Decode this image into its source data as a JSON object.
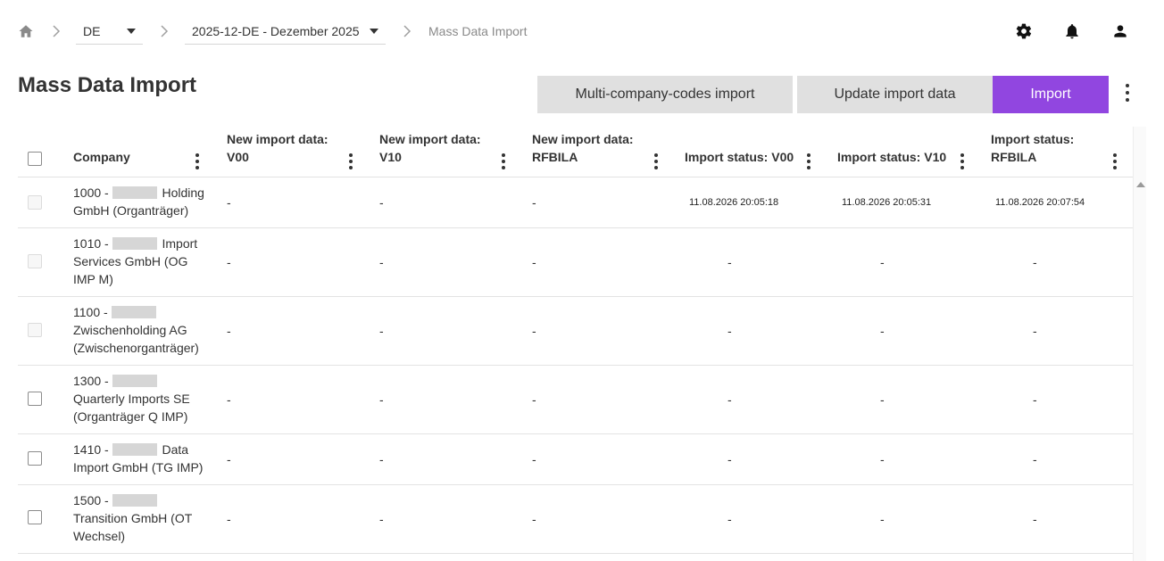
{
  "breadcrumb": {
    "country": "DE",
    "period": "2025-12-DE - Dezember 2025",
    "current": "Mass Data Import"
  },
  "header_icons": [
    "gear-icon",
    "bell-icon",
    "user-icon"
  ],
  "page": {
    "title": "Mass Data Import"
  },
  "actions": {
    "multi_company": "Multi-company-codes import",
    "update": "Update import data",
    "import": "Import"
  },
  "colors": {
    "primary": "#9146e0",
    "secondary_button": "#e0e0e0"
  },
  "table": {
    "columns": [
      {
        "line1": "",
        "line2": "Company"
      },
      {
        "line1": "New import data:",
        "line2": "V00"
      },
      {
        "line1": "New import data:",
        "line2": "V10"
      },
      {
        "line1": "New import data:",
        "line2": "RFBILA"
      },
      {
        "line1": "",
        "line2": "Import status: V00"
      },
      {
        "line1": "",
        "line2": "Import status: V10"
      },
      {
        "line1": "Import status:",
        "line2": "RFBILA"
      }
    ],
    "rows": [
      {
        "code": "1000 -",
        "tail": "Holding",
        "rest": [
          "GmbH (Organträger)"
        ],
        "v00": "-",
        "v10": "-",
        "rfbila": "-",
        "s_v00": "11.08.2026 20:05:18",
        "s_v10": "11.08.2026 20:05:31",
        "s_rfbila": "11.08.2026 20:07:54",
        "checkbox_enabled": false
      },
      {
        "code": "1010 -",
        "tail": "Import",
        "rest": [
          "Services GmbH (OG",
          "IMP M)"
        ],
        "v00": "-",
        "v10": "-",
        "rfbila": "-",
        "s_v00": "-",
        "s_v10": "-",
        "s_rfbila": "-",
        "checkbox_enabled": false
      },
      {
        "code": "1100 -",
        "tail": "",
        "rest": [
          "Zwischenholding AG",
          "(Zwischenorganträger)"
        ],
        "v00": "-",
        "v10": "-",
        "rfbila": "-",
        "s_v00": "-",
        "s_v10": "-",
        "s_rfbila": "-",
        "checkbox_enabled": false
      },
      {
        "code": "1300 -",
        "tail": "",
        "rest": [
          "Quarterly Imports SE",
          "(Organträger Q IMP)"
        ],
        "v00": "-",
        "v10": "-",
        "rfbila": "-",
        "s_v00": "-",
        "s_v10": "-",
        "s_rfbila": "-",
        "checkbox_enabled": true
      },
      {
        "code": "1410 -",
        "tail": "Data",
        "rest": [
          "Import GmbH (TG IMP)"
        ],
        "v00": "-",
        "v10": "-",
        "rfbila": "-",
        "s_v00": "-",
        "s_v10": "-",
        "s_rfbila": "-",
        "checkbox_enabled": true
      },
      {
        "code": "1500 -",
        "tail": "",
        "rest": [
          "Transition GmbH (OT",
          "Wechsel)"
        ],
        "v00": "-",
        "v10": "-",
        "rfbila": "-",
        "s_v00": "-",
        "s_v10": "-",
        "s_rfbila": "-",
        "checkbox_enabled": true
      }
    ]
  }
}
